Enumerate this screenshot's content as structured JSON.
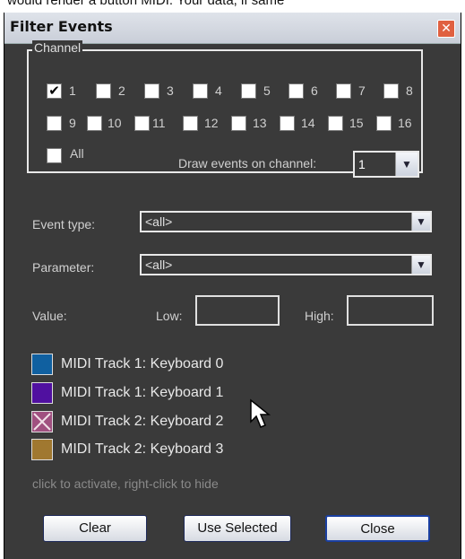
{
  "top_strip_text": "would render a button MIDI. Your data, if same",
  "dialog": {
    "title": "Filter Events",
    "close_symbol": "✕"
  },
  "channel": {
    "legend": "Channel",
    "items": [
      {
        "label": "1",
        "checked": true
      },
      {
        "label": "2",
        "checked": false
      },
      {
        "label": "3",
        "checked": false
      },
      {
        "label": "4",
        "checked": false
      },
      {
        "label": "5",
        "checked": false
      },
      {
        "label": "6",
        "checked": false
      },
      {
        "label": "7",
        "checked": false
      },
      {
        "label": "8",
        "checked": false
      },
      {
        "label": "9",
        "checked": false
      },
      {
        "label": "10",
        "checked": false
      },
      {
        "label": "11",
        "checked": false
      },
      {
        "label": "12",
        "checked": false
      },
      {
        "label": "13",
        "checked": false
      },
      {
        "label": "14",
        "checked": false
      },
      {
        "label": "15",
        "checked": false
      },
      {
        "label": "16",
        "checked": false
      }
    ],
    "all_label": "All",
    "all_checked": false,
    "draw_label": "Draw events on channel:",
    "draw_value": "1"
  },
  "event_type": {
    "label": "Event type:",
    "value": "<all>"
  },
  "parameter": {
    "label": "Parameter:",
    "value": "<all>"
  },
  "value": {
    "label": "Value:",
    "low_label": "Low:",
    "low_value": "",
    "high_label": "High:",
    "high_value": ""
  },
  "tracks": [
    {
      "label": "MIDI Track 1: Keyboard 0",
      "color": "#1060a0",
      "hidden": false
    },
    {
      "label": "MIDI Track 1: Keyboard 1",
      "color": "#5010a0",
      "hidden": false
    },
    {
      "label": "MIDI Track 2: Keyboard 2",
      "color": "#a05080",
      "hidden": true
    },
    {
      "label": "MIDI Track 2: Keyboard 3",
      "color": "#a07830",
      "hidden": false
    }
  ],
  "hint": "click to activate, right-click to hide",
  "buttons": {
    "clear": "Clear",
    "use_selected": "Use Selected",
    "close": "Close"
  },
  "colors": {
    "background": "#3a3a3a",
    "check": "#000000"
  }
}
